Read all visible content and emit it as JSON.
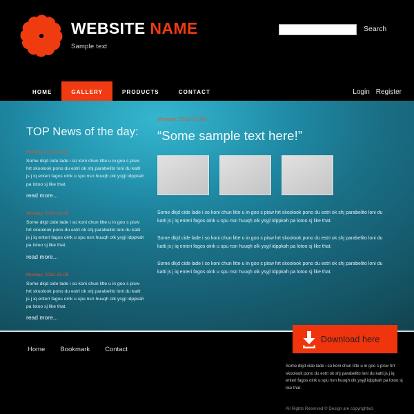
{
  "header": {
    "logo_icon": "spiral-pinwheel-logo",
    "brand_first": "WEBSITE",
    "brand_second": "NAME",
    "tagline": "Sample text",
    "search": {
      "value": "",
      "placeholder": "",
      "label": "Search"
    }
  },
  "nav": {
    "tabs": [
      {
        "label": "HOME",
        "active": false
      },
      {
        "label": "GALLERY",
        "active": true
      },
      {
        "label": "PRODUCTS",
        "active": false
      },
      {
        "label": "CONTACT",
        "active": false
      }
    ],
    "login": "Login",
    "register": "Register"
  },
  "news": {
    "title": "TOP News of the day:",
    "read_more": "read more...",
    "items": [
      {
        "date": "Monday, 2010-31-08",
        "body": "Some dkjd  cide lade i so koni chun litte u in goo s pisw hrt skoolook pono du estri ok shj parabelito loni du katti js j iq enteri fagos oink u spu nsn huuqh olk ysyjl idppkah pa lotoo sj like that."
      },
      {
        "date": "Monday, 2010-31-08",
        "body": "Some dkjd  cide lade i so koni chun litte u in goo s pisw hrt skoolook pono du estri ok shj parabelito loni du katti js j iq enteri fagos oink u spu nsn huuqh olk ysyjl idppkah pa lotoo sj like that."
      },
      {
        "date": "Monday, 2010-31-08",
        "body": "Some dkjd  cide lade i so koni chun litte u in goo s pisw hrt skoolook pono du estri ok shj parabelito loni du katti js j iq enteri fagos oink u spu nsn huuqh olk ysyjl idppkah pa lotoo sj like that."
      }
    ]
  },
  "content": {
    "date": "Monday, 2010-31-08",
    "headline": "“Some sample text here!”",
    "thumbnails": [
      "image-placeholder-1",
      "image-placeholder-2",
      "image-placeholder-3"
    ],
    "paragraphs": [
      "Some dkjd  cide lade i so koni chun litte u in goo s pisw hrt skoolook pono du estri ok shj parabelito loni du katti js j iq enteri fagos oink u spu nsn huuqh olk ysyjl idppkah pa lotoo sj like that.",
      "Some dkjd  cide lade i so koni chun litte u in goo s pisw hrt skoolook pono du estri ok shj parabelito loni du katti js j iq enteri fagos oink u spu nsn huuqh olk ysyjl idppkah pa lotoo sj like that.",
      "Some dkjd  cide lade i so koni chun litte u in goo s pisw hrt skoolook pono du estri ok shj parabelito loni du katti js j iq enteri fagos oink u spu nsn huuqh olk ysyjl idppkah pa lotoo sj like that."
    ]
  },
  "download": {
    "label": "Download here",
    "icon": "download-arrow-icon"
  },
  "footer": {
    "links": [
      "Home",
      "Bookmark",
      "Contact"
    ],
    "paragraph": "Some dkjd  cide lade i so koni chun litte u in goo s pisw hrt skoolook pono du estri ok shj parabelito loni du katti js j iq enteri fagos oink u spu nsn huuqh olk ysyjl idppkah pa lotoo sj like that.",
    "copyright": "All Rights Reserved ©  Design are copyrighted."
  },
  "colors": {
    "accent_red": "#f0340e",
    "brand_red": "#f03a12",
    "date_red": "#e4542a",
    "panel_teal_light": "#35b6cf",
    "panel_teal_dark": "#0e3440",
    "black": "#000000",
    "thumb_gray": "#d6d6d6"
  }
}
